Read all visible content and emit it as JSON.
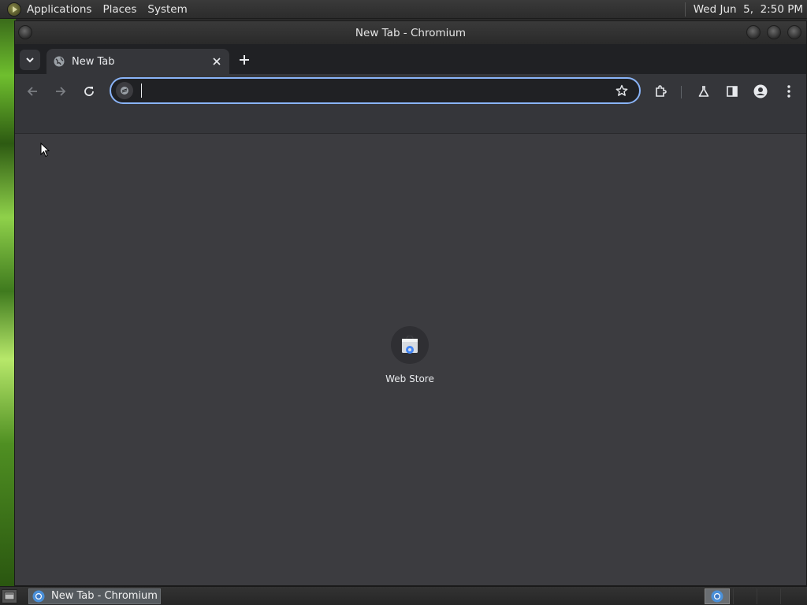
{
  "top_panel": {
    "menus": [
      "Applications",
      "Places",
      "System"
    ],
    "clock": "Wed Jun  5,  2:50 PM"
  },
  "window": {
    "title": "New Tab - Chromium"
  },
  "tabs": [
    {
      "label": "New Tab",
      "active": true
    }
  ],
  "omnibox": {
    "value": "",
    "placeholder": ""
  },
  "shortcuts": [
    {
      "label": "Web Store",
      "icon": "web-store-icon"
    }
  ],
  "taskbar": {
    "items": [
      {
        "label": "New Tab - Chromium",
        "icon": "chromium-icon"
      }
    ]
  },
  "colors": {
    "accent": "#8ab4f8",
    "content_bg": "#3c3c40",
    "toolbar_bg": "#35363a",
    "tabstrip_bg": "#202124"
  }
}
